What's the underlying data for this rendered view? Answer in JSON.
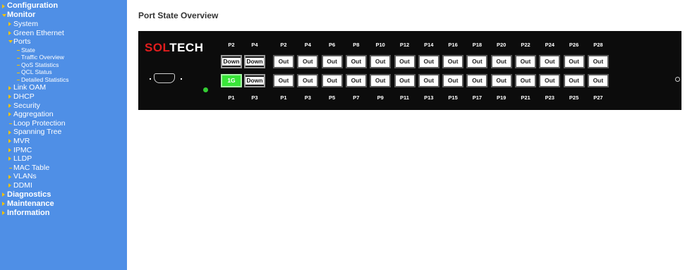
{
  "sidebar": {
    "items": [
      {
        "label": "Configuration",
        "level": 0,
        "marker": "arrow"
      },
      {
        "label": "Monitor",
        "level": 0,
        "marker": "down"
      },
      {
        "label": "System",
        "level": 1,
        "marker": "arrow"
      },
      {
        "label": "Green Ethernet",
        "level": 1,
        "marker": "arrow"
      },
      {
        "label": "Ports",
        "level": 1,
        "marker": "down"
      },
      {
        "label": "State",
        "level": 2,
        "marker": "dash"
      },
      {
        "label": "Traffic Overview",
        "level": 2,
        "marker": "dash"
      },
      {
        "label": "QoS Statistics",
        "level": 2,
        "marker": "dash"
      },
      {
        "label": "QCL Status",
        "level": 2,
        "marker": "dash"
      },
      {
        "label": "Detailed Statistics",
        "level": 2,
        "marker": "dash"
      },
      {
        "label": "Link OAM",
        "level": 1,
        "marker": "arrow"
      },
      {
        "label": "DHCP",
        "level": 1,
        "marker": "arrow"
      },
      {
        "label": "Security",
        "level": 1,
        "marker": "arrow"
      },
      {
        "label": "Aggregation",
        "level": 1,
        "marker": "arrow"
      },
      {
        "label": "Loop Protection",
        "level": 1,
        "marker": "dash"
      },
      {
        "label": "Spanning Tree",
        "level": 1,
        "marker": "arrow"
      },
      {
        "label": "MVR",
        "level": 1,
        "marker": "arrow"
      },
      {
        "label": "IPMC",
        "level": 1,
        "marker": "arrow"
      },
      {
        "label": "LLDP",
        "level": 1,
        "marker": "arrow"
      },
      {
        "label": "MAC Table",
        "level": 1,
        "marker": "dash"
      },
      {
        "label": "VLANs",
        "level": 1,
        "marker": "arrow"
      },
      {
        "label": "DDMI",
        "level": 1,
        "marker": "arrow"
      },
      {
        "label": "Diagnostics",
        "level": 0,
        "marker": "arrow"
      },
      {
        "label": "Maintenance",
        "level": 0,
        "marker": "arrow"
      },
      {
        "label": "Information",
        "level": 0,
        "marker": "arrow"
      }
    ]
  },
  "main": {
    "title": "Port State Overview",
    "brand_sol": "SOL",
    "brand_tech": "TECH",
    "top_labels": [
      "P2",
      "P4",
      "P2",
      "P4",
      "P6",
      "P8",
      "P10",
      "P12",
      "P14",
      "P16",
      "P18",
      "P20",
      "P22",
      "P24",
      "P26",
      "P28"
    ],
    "bottom_labels": [
      "P1",
      "P3",
      "P1",
      "P3",
      "P5",
      "P7",
      "P9",
      "P11",
      "P13",
      "P15",
      "P17",
      "P19",
      "P21",
      "P23",
      "P25",
      "P27"
    ],
    "top_row": [
      {
        "text": "Down",
        "state": "down"
      },
      {
        "text": "Down",
        "state": "down"
      },
      {
        "text": "Out",
        "state": "out"
      },
      {
        "text": "Out",
        "state": "out"
      },
      {
        "text": "Out",
        "state": "out"
      },
      {
        "text": "Out",
        "state": "out"
      },
      {
        "text": "Out",
        "state": "out"
      },
      {
        "text": "Out",
        "state": "out"
      },
      {
        "text": "Out",
        "state": "out"
      },
      {
        "text": "Out",
        "state": "out"
      },
      {
        "text": "Out",
        "state": "out"
      },
      {
        "text": "Out",
        "state": "out"
      },
      {
        "text": "Out",
        "state": "out"
      },
      {
        "text": "Out",
        "state": "out"
      },
      {
        "text": "Out",
        "state": "out"
      },
      {
        "text": "Out",
        "state": "out"
      }
    ],
    "bottom_row": [
      {
        "text": "1G",
        "state": "up"
      },
      {
        "text": "Down",
        "state": "down"
      },
      {
        "text": "Out",
        "state": "out"
      },
      {
        "text": "Out",
        "state": "out"
      },
      {
        "text": "Out",
        "state": "out"
      },
      {
        "text": "Out",
        "state": "out"
      },
      {
        "text": "Out",
        "state": "out"
      },
      {
        "text": "Out",
        "state": "out"
      },
      {
        "text": "Out",
        "state": "out"
      },
      {
        "text": "Out",
        "state": "out"
      },
      {
        "text": "Out",
        "state": "out"
      },
      {
        "text": "Out",
        "state": "out"
      },
      {
        "text": "Out",
        "state": "out"
      },
      {
        "text": "Out",
        "state": "out"
      },
      {
        "text": "Out",
        "state": "out"
      },
      {
        "text": "Out",
        "state": "out"
      }
    ]
  },
  "colors": {
    "sidebar_bg": "#4f8fe6",
    "arrow": "#f5c200",
    "brand_red": "#e11d1d",
    "link_up": "#39e639",
    "status_led": "#33cc33"
  }
}
